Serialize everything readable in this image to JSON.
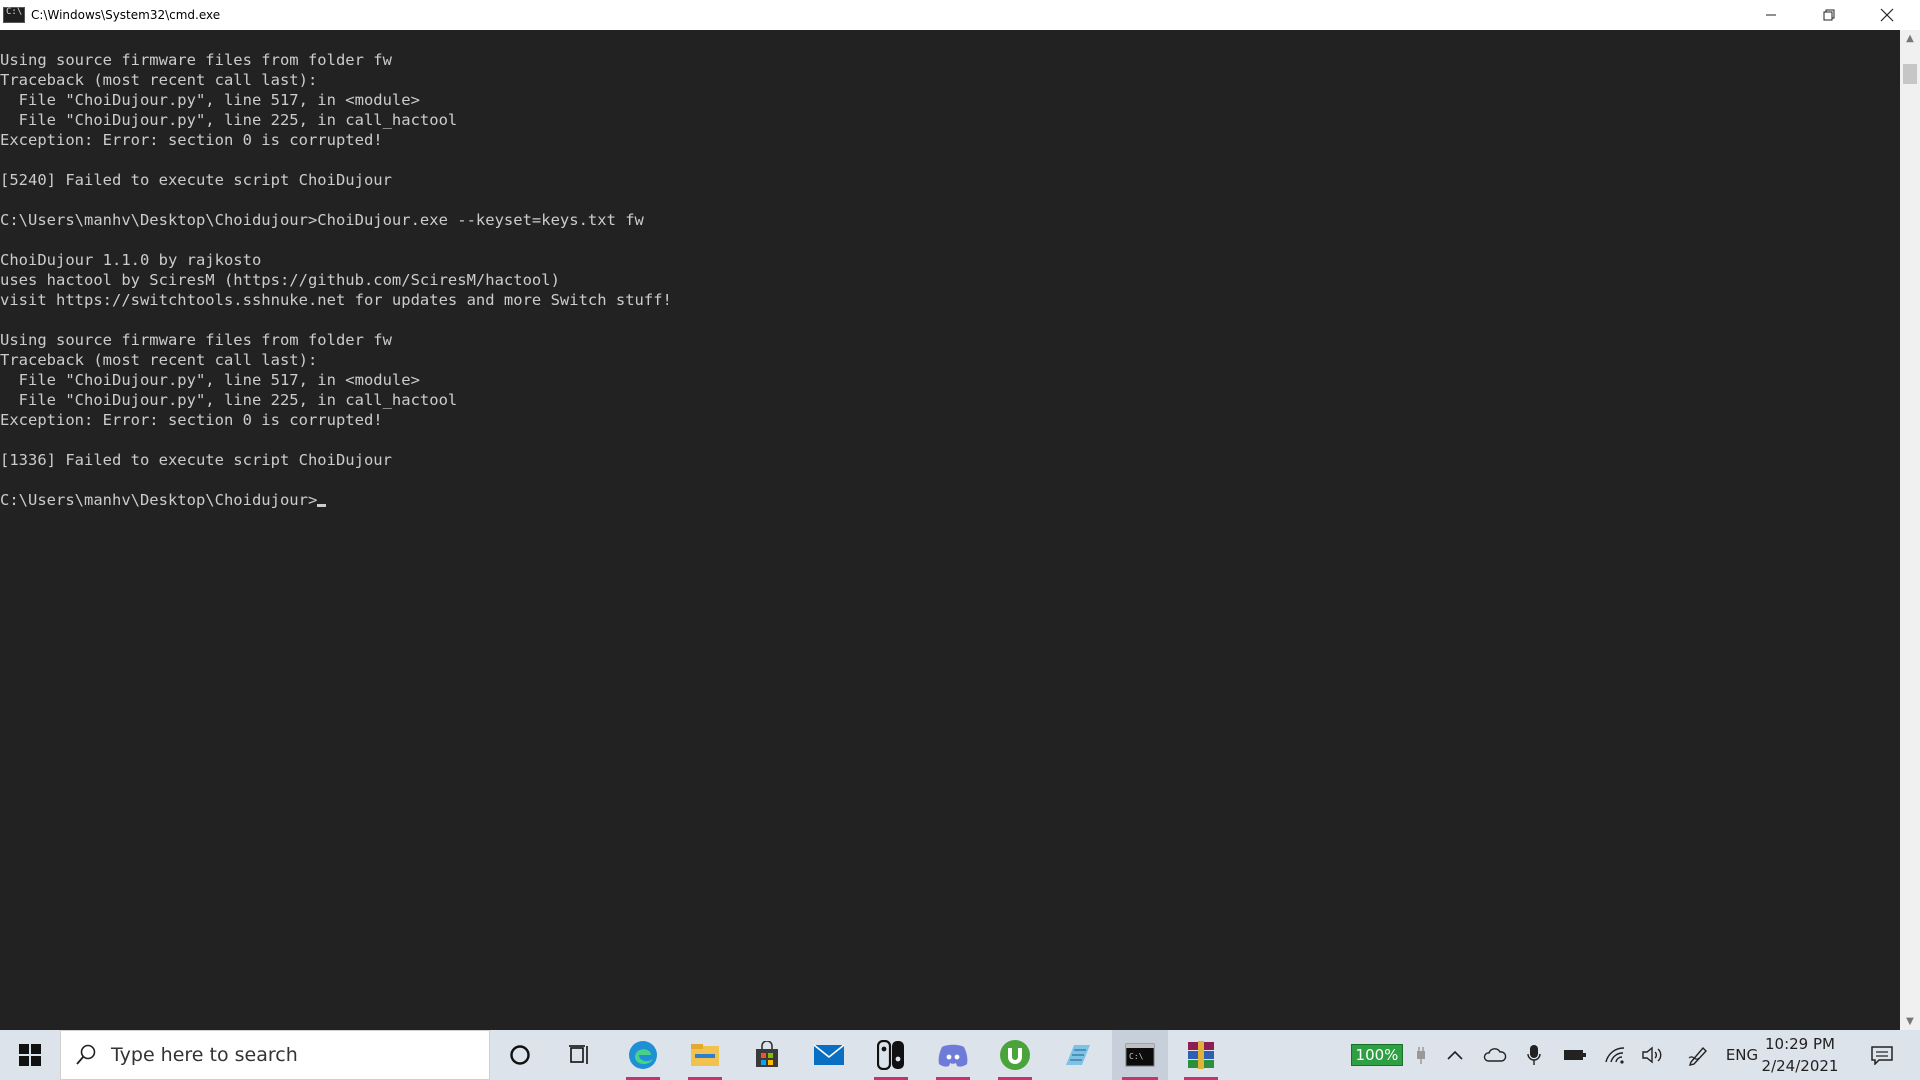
{
  "window": {
    "title": "C:\\Windows\\System32\\cmd.exe",
    "minimize_icon": "minimize-icon",
    "restore_icon": "restore-icon",
    "close_icon": "close-icon"
  },
  "console": {
    "lines": [
      "Using source firmware files from folder fw",
      "Traceback (most recent call last):",
      "  File \"ChoiDujour.py\", line 517, in <module>",
      "  File \"ChoiDujour.py\", line 225, in call_hactool",
      "Exception: Error: section 0 is corrupted!",
      "",
      "[5240] Failed to execute script ChoiDujour",
      "",
      "C:\\Users\\manhv\\Desktop\\Choidujour>ChoiDujour.exe --keyset=keys.txt fw",
      "",
      "ChoiDujour 1.1.0 by rajkosto",
      "uses hactool by SciresM (https://github.com/SciresM/hactool)",
      "visit https://switchtools.sshnuke.net for updates and more Switch stuff!",
      "",
      "Using source firmware files from folder fw",
      "Traceback (most recent call last):",
      "  File \"ChoiDujour.py\", line 517, in <module>",
      "  File \"ChoiDujour.py\", line 225, in call_hactool",
      "Exception: Error: section 0 is corrupted!",
      "",
      "[1336] Failed to execute script ChoiDujour",
      ""
    ],
    "prompt": "C:\\Users\\manhv\\Desktop\\Choidujour>",
    "colors": {
      "background": "#222222",
      "text": "#cccccc"
    }
  },
  "taskbar": {
    "search_placeholder": "Type here to search",
    "apps": [
      "windows-start-icon",
      "cortana-icon",
      "task-view-icon",
      "edge-icon",
      "file-explorer-icon",
      "microsoft-store-icon",
      "mail-icon",
      "nintendo-switch-icon",
      "discord-icon",
      "utorrent-icon",
      "notepad-icon",
      "cmd-icon",
      "winrar-icon"
    ],
    "tray": {
      "battery_percent": "100%",
      "language": "ENG",
      "time": "10:29 PM",
      "date": "2/24/2021"
    }
  }
}
